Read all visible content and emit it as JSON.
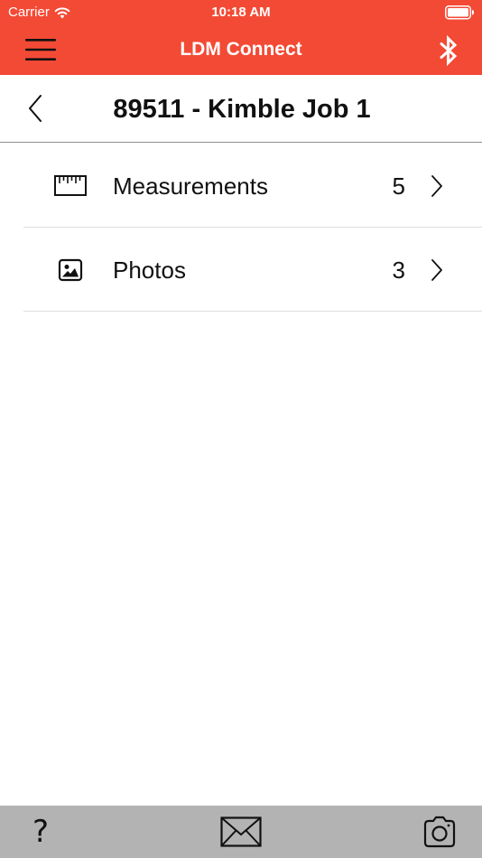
{
  "status_bar": {
    "carrier": "Carrier",
    "time": "10:18 AM",
    "wifi_icon": "wifi-icon",
    "battery_icon": "battery-full-icon"
  },
  "nav_bar": {
    "title": "LDM Connect",
    "menu_icon": "hamburger-menu-icon",
    "bluetooth_icon": "bluetooth-icon",
    "background_color": "#f34a35"
  },
  "page": {
    "title": "89511 - Kimble Job 1",
    "back_icon": "chevron-left-icon"
  },
  "items": [
    {
      "label": "Measurements",
      "count": "5",
      "icon": "ruler-icon"
    },
    {
      "label": "Photos",
      "count": "3",
      "icon": "photo-icon"
    }
  ],
  "tab_bar": {
    "background_color": "#b3b3b3",
    "help_label": "?",
    "items": [
      "help-icon",
      "mail-icon",
      "camera-icon"
    ]
  }
}
